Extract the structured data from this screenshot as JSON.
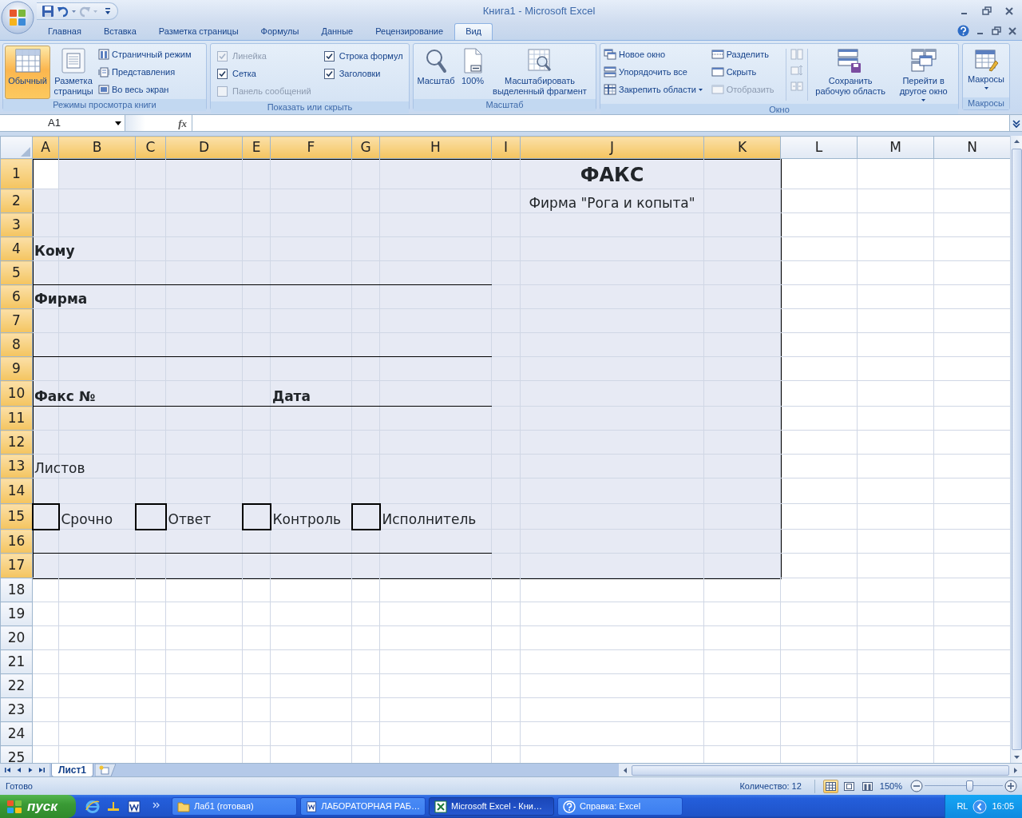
{
  "window": {
    "title": "Книга1 - Microsoft Excel"
  },
  "tabs": [
    {
      "label": "Главная",
      "selected": false
    },
    {
      "label": "Вставка",
      "selected": false
    },
    {
      "label": "Разметка страницы",
      "selected": false
    },
    {
      "label": "Формулы",
      "selected": false
    },
    {
      "label": "Данные",
      "selected": false
    },
    {
      "label": "Рецензирование",
      "selected": false
    },
    {
      "label": "Вид",
      "selected": true
    }
  ],
  "views_group": {
    "title": "Режимы просмотра книги",
    "large_buttons": [
      {
        "label": "Обычный",
        "selected": true
      },
      {
        "label": "Разметка\nстраницы",
        "selected": false
      }
    ],
    "small_buttons": [
      "Страничный режим",
      "Представления",
      "Во весь экран"
    ]
  },
  "show_group": {
    "title": "Показать или скрыть",
    "checkboxes": [
      {
        "label": "Линейка",
        "checked": true,
        "disabled": true
      },
      {
        "label": "Сетка",
        "checked": true,
        "disabled": false
      },
      {
        "label": "Панель сообщений",
        "checked": false,
        "disabled": true
      },
      {
        "label": "Строка формул",
        "checked": true,
        "disabled": false
      },
      {
        "label": "Заголовки",
        "checked": true,
        "disabled": false
      }
    ]
  },
  "zoom_group": {
    "title": "Масштаб",
    "buttons": [
      "Масштаб",
      "100%",
      "Масштабировать\nвыделенный фрагмент"
    ]
  },
  "window_group": {
    "title": "Окно",
    "small_buttons": [
      {
        "label": "Новое окно",
        "dropdown": false,
        "disabled": false
      },
      {
        "label": "Упорядочить все",
        "dropdown": false,
        "disabled": false
      },
      {
        "label": "Закрепить области",
        "dropdown": true,
        "disabled": false
      },
      {
        "label": "Разделить",
        "dropdown": false,
        "disabled": false
      },
      {
        "label": "Скрыть",
        "dropdown": false,
        "disabled": false
      },
      {
        "label": "Отобразить",
        "dropdown": false,
        "disabled": true
      }
    ],
    "large_buttons": [
      {
        "label": "Сохранить\nрабочую область",
        "dropdown": false
      },
      {
        "label": "Перейти в\nдругое окно",
        "dropdown": true
      }
    ]
  },
  "macros_group": {
    "title": "Макросы",
    "buttons": [
      {
        "label": "Макросы",
        "dropdown": true
      }
    ]
  },
  "formula_bar": {
    "name_box": "A1",
    "function_button": "fx"
  },
  "sheet": {
    "columns": [
      {
        "label": "A",
        "selected": true
      },
      {
        "label": "B",
        "selected": true
      },
      {
        "label": "C",
        "selected": true
      },
      {
        "label": "D",
        "selected": true
      },
      {
        "label": "E",
        "selected": true
      },
      {
        "label": "F",
        "selected": true
      },
      {
        "label": "G",
        "selected": true
      },
      {
        "label": "H",
        "selected": true
      },
      {
        "label": "I",
        "selected": true
      },
      {
        "label": "J",
        "selected": true
      },
      {
        "label": "K",
        "selected": true
      },
      {
        "label": "L",
        "selected": false
      },
      {
        "label": "M",
        "selected": false
      },
      {
        "label": "N",
        "selected": false
      }
    ],
    "rows": [
      {
        "label": "1",
        "selected": true,
        "bottom_rule": false,
        "cells": [
          {
            "kind": "empty"
          },
          {
            "kind": "empty"
          },
          {
            "kind": "empty"
          },
          {
            "kind": "empty"
          },
          {
            "kind": "empty"
          },
          {
            "kind": "empty"
          },
          {
            "kind": "empty"
          },
          {
            "kind": "empty"
          },
          {
            "kind": "empty"
          },
          {
            "kind": "heading",
            "text": "ФАКС"
          }
        ]
      },
      {
        "label": "2",
        "selected": true,
        "bottom_rule": false,
        "cells": [
          {
            "kind": "empty"
          },
          {
            "kind": "empty"
          },
          {
            "kind": "empty"
          },
          {
            "kind": "empty"
          },
          {
            "kind": "empty"
          },
          {
            "kind": "empty"
          },
          {
            "kind": "empty"
          },
          {
            "kind": "empty"
          },
          {
            "kind": "empty"
          },
          {
            "kind": "subheading",
            "text": "Фирма \"Рога и копыта\""
          }
        ]
      },
      {
        "label": "3",
        "selected": true,
        "bottom_rule": false
      },
      {
        "label": "4",
        "selected": true,
        "bottom_rule": false,
        "cells": [
          {
            "kind": "label",
            "text": "Кому"
          }
        ]
      },
      {
        "label": "5",
        "selected": true,
        "bottom_rule": true
      },
      {
        "label": "6",
        "selected": true,
        "bottom_rule": false,
        "cells": [
          {
            "kind": "label",
            "text": "Фирма"
          }
        ]
      },
      {
        "label": "7",
        "selected": true,
        "bottom_rule": false
      },
      {
        "label": "8",
        "selected": true,
        "bottom_rule": true
      },
      {
        "label": "9",
        "selected": true,
        "bottom_rule": false
      },
      {
        "label": "10",
        "selected": true,
        "bottom_rule": true,
        "cells": [
          {
            "kind": "label",
            "text": "Факс №"
          },
          {
            "kind": "empty"
          },
          {
            "kind": "empty"
          },
          {
            "kind": "empty"
          },
          {
            "kind": "empty"
          },
          {
            "kind": "label",
            "text": "Дата"
          }
        ]
      },
      {
        "label": "11",
        "selected": true,
        "bottom_rule": false
      },
      {
        "label": "12",
        "selected": true,
        "bottom_rule": false
      },
      {
        "label": "13",
        "selected": true,
        "bottom_rule": false,
        "cells": [
          {
            "kind": "text",
            "text": "Листов"
          }
        ]
      },
      {
        "label": "14",
        "selected": true,
        "bottom_rule": false
      },
      {
        "label": "15",
        "selected": true,
        "bottom_rule": false,
        "cells": [
          {
            "kind": "box"
          },
          {
            "kind": "text",
            "text": "Срочно"
          },
          {
            "kind": "box"
          },
          {
            "kind": "text",
            "text": "Ответ"
          },
          {
            "kind": "box"
          },
          {
            "kind": "text",
            "text": "Контроль"
          },
          {
            "kind": "box"
          },
          {
            "kind": "text",
            "text": "Исполнитель"
          }
        ]
      },
      {
        "label": "16",
        "selected": true,
        "bottom_rule": true
      },
      {
        "label": "17",
        "selected": true,
        "bottom_rule": false
      },
      {
        "label": "18",
        "selected": false,
        "bottom_rule": false
      },
      {
        "label": "19",
        "selected": false,
        "bottom_rule": false
      },
      {
        "label": "20",
        "selected": false,
        "bottom_rule": false
      },
      {
        "label": "21",
        "selected": false,
        "bottom_rule": false
      },
      {
        "label": "22",
        "selected": false,
        "bottom_rule": false
      },
      {
        "label": "23",
        "selected": false,
        "bottom_rule": false
      },
      {
        "label": "24",
        "selected": false,
        "bottom_rule": false
      },
      {
        "label": "25",
        "selected": false
      }
    ]
  },
  "sheet_tabs": [
    {
      "label": "Лист1",
      "selected": true
    }
  ],
  "status_bar": {
    "status": "Готово",
    "count": "Количество: 12",
    "view_buttons": [
      {
        "selected": true
      },
      {
        "selected": false
      },
      {
        "selected": false
      }
    ],
    "zoom": "150%",
    "zoom_slider": {
      "level": 0.57
    }
  },
  "taskbar": {
    "start": "пуск",
    "tasks": [
      {
        "label": "Лаб1 (готовая)",
        "kind": "folder",
        "selected": false
      },
      {
        "label": "ЛАБОРАТОРНАЯ РАБ…",
        "kind": "document",
        "selected": false
      },
      {
        "label": "Microsoft Excel - Кни…",
        "kind": "spreadsheet",
        "selected": true
      },
      {
        "label": "Справка: Excel",
        "kind": "help",
        "selected": false
      }
    ],
    "language": "RL",
    "clock": "16:05"
  }
}
